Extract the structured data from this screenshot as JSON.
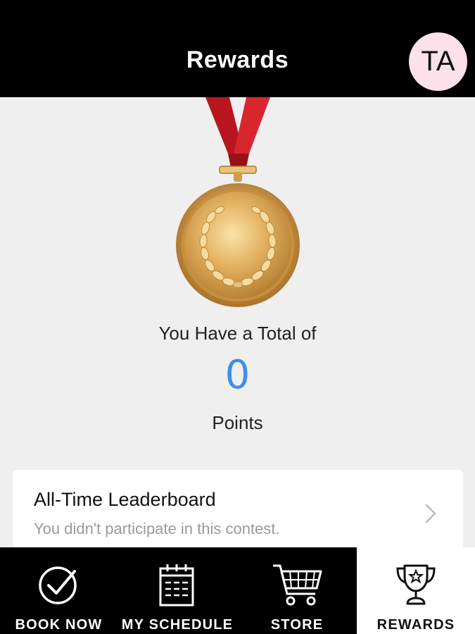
{
  "header": {
    "title": "Rewards",
    "avatar_initials": "TA"
  },
  "summary": {
    "total_label": "You Have a Total of",
    "points_value": "0",
    "points_label": "Points"
  },
  "leaderboard": {
    "title": "All-Time Leaderboard",
    "subtitle": "You didn't participate in this contest."
  },
  "tabs": [
    {
      "label": "BOOK NOW",
      "icon": "check-circle-icon",
      "active": false
    },
    {
      "label": "MY SCHEDULE",
      "icon": "calendar-icon",
      "active": false
    },
    {
      "label": "STORE",
      "icon": "cart-icon",
      "active": false
    },
    {
      "label": "REWARDS",
      "icon": "trophy-icon",
      "active": true
    }
  ],
  "colors": {
    "header_bg": "#000000",
    "accent_points": "#3f8ee8",
    "avatar_bg": "#fce0ea",
    "medal_gold": "#d9a447",
    "ribbon_red": "#c8202a"
  }
}
